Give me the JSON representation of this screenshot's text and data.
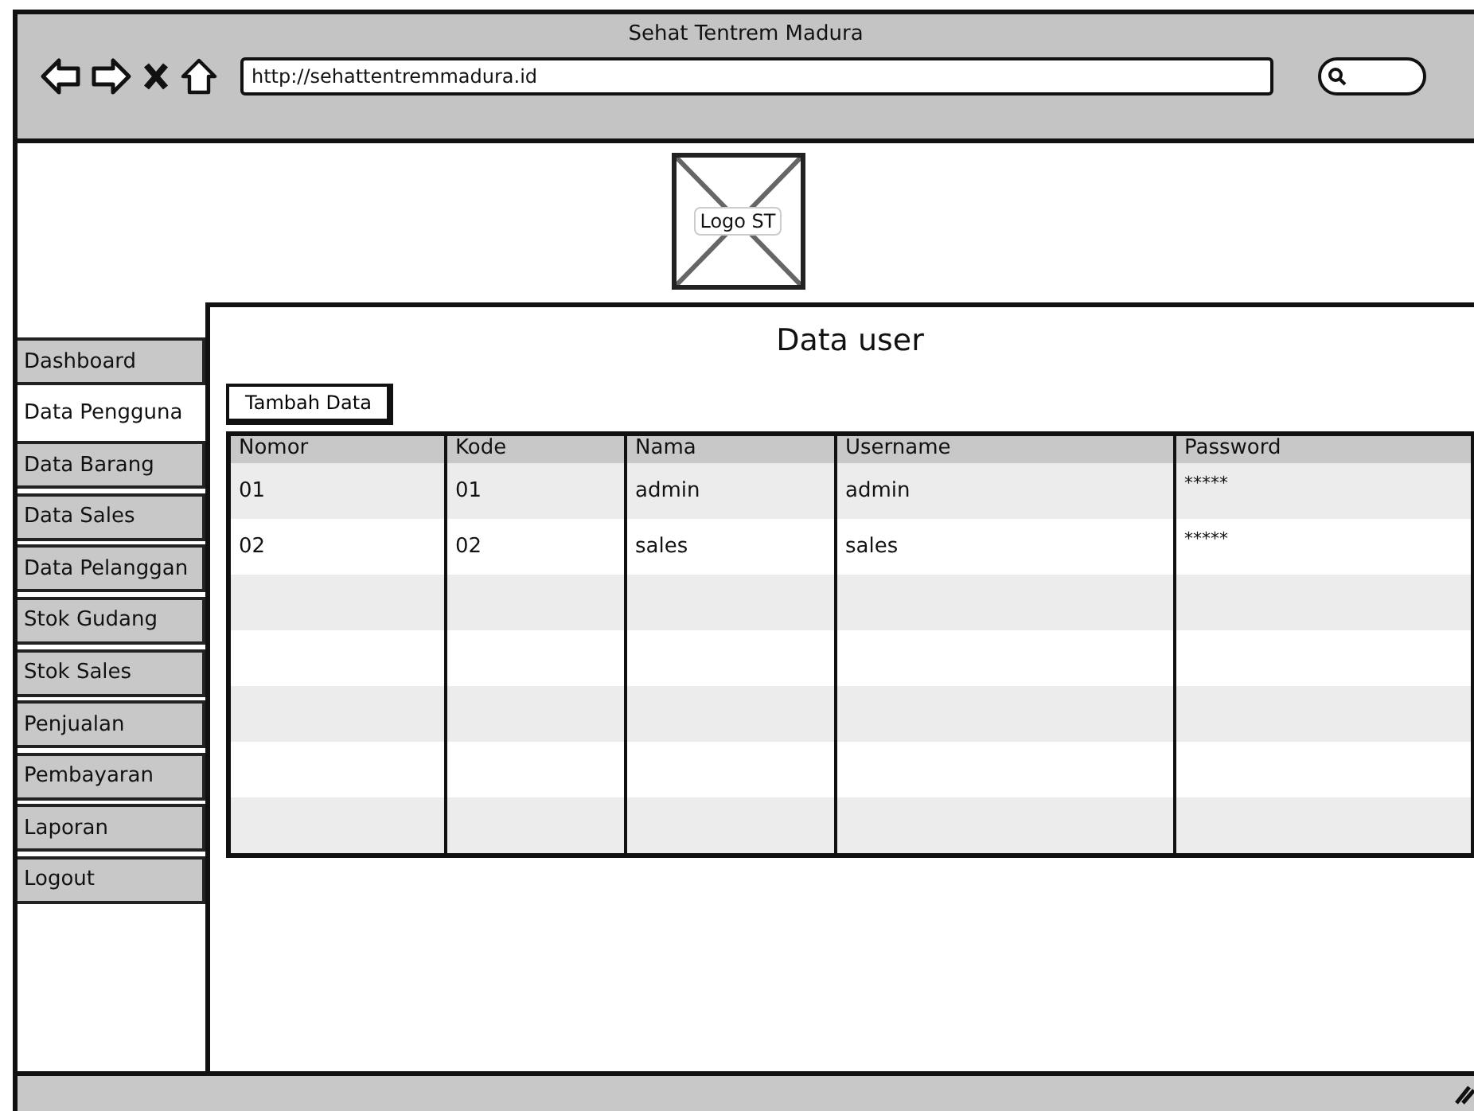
{
  "window": {
    "title": "Sehat Tentrem Madura"
  },
  "browser": {
    "url": "http://sehattentremmadura.id"
  },
  "logo": {
    "label": "Logo ST"
  },
  "page": {
    "heading": "Data user"
  },
  "sidebar": {
    "items": [
      {
        "label": "Dashboard",
        "selected": false
      },
      {
        "label": "Data Pengguna",
        "selected": true
      },
      {
        "label": "Data Barang",
        "selected": false
      },
      {
        "label": "Data Sales",
        "selected": false
      },
      {
        "label": "Data Pelanggan",
        "selected": false
      },
      {
        "label": "Stok Gudang",
        "selected": false
      },
      {
        "label": "Stok Sales",
        "selected": false
      },
      {
        "label": "Penjualan",
        "selected": false
      },
      {
        "label": "Pembayaran",
        "selected": false
      },
      {
        "label": "Laporan",
        "selected": false
      },
      {
        "label": "Logout",
        "selected": false
      }
    ]
  },
  "toolbar": {
    "add_button": "Tambah Data"
  },
  "table": {
    "columns": [
      "Nomor",
      "Kode",
      "Nama",
      "Username",
      "Password"
    ],
    "rows": [
      [
        "01",
        "01",
        "admin",
        "admin",
        "*****"
      ],
      [
        "02",
        "02",
        "sales",
        "sales",
        "*****"
      ]
    ]
  }
}
